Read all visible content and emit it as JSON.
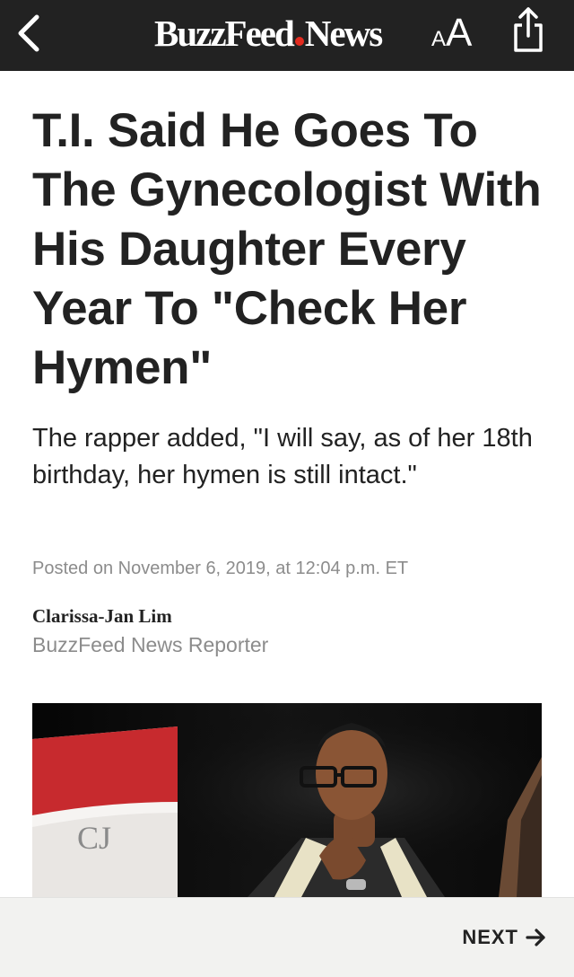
{
  "header": {
    "logo_part1": "BuzzFeed",
    "logo_part2": "News",
    "logo_dot_color": "#e32b1f",
    "text_size_small": "A",
    "text_size_large": "A",
    "icons": [
      "chevron-left-icon",
      "text-size-icon",
      "share-icon"
    ]
  },
  "article": {
    "headline": "T.I. Said He Goes To The Gynecologist With His Daughter Every Year To \"Check Her Hymen\"",
    "dek": "The rapper added, \"I will say, as of her 18th birthday, her hymen is still intact.\"",
    "timestamp": "Posted on November 6, 2019, at 12:04 p.m. ET",
    "author": {
      "name": "Clarissa-Jan Lim",
      "title": "BuzzFeed News Reporter"
    }
  },
  "footer": {
    "next_label": "NEXT",
    "next_icon": "arrow-right-icon"
  },
  "colors": {
    "header_bg": "#222222",
    "accent_red": "#e32b1f",
    "muted_text": "#8c8c8c",
    "footer_bg": "#f2f2f0"
  }
}
